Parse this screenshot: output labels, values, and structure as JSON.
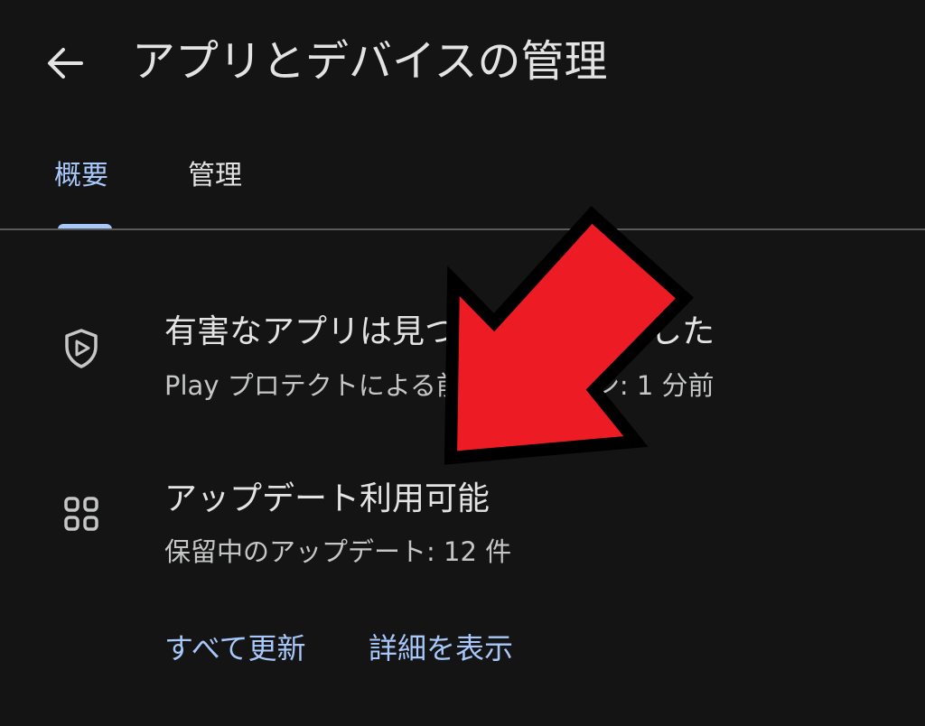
{
  "header": {
    "back_icon": "arrow-left-icon",
    "title": "アプリとデバイスの管理"
  },
  "tabs": [
    {
      "label": "概要",
      "selected": true
    },
    {
      "label": "管理",
      "selected": false
    }
  ],
  "protect": {
    "icon": "shield-play-icon",
    "title": "有害なアプリは見つかりませんでした",
    "subtitle": "Play プロテクトによる前回のスキャン: 1 分前"
  },
  "updates": {
    "icon": "apps-grid-icon",
    "title": "アップデート利用可能",
    "subtitle": "保留中のアップデート: 12 件"
  },
  "actions": {
    "update_all": "すべて更新",
    "view_details": "詳細を表示"
  },
  "colors": {
    "background": "#141414",
    "accent": "#a8c7fa",
    "arrow": "#ed1c24"
  }
}
